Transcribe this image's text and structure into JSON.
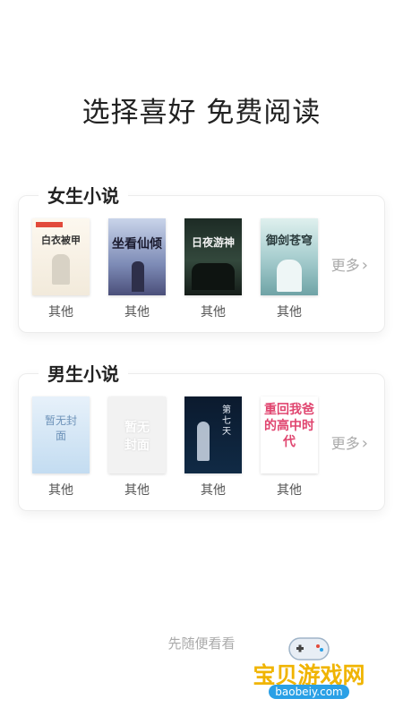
{
  "header": {
    "title": "选择喜好 免费阅读"
  },
  "sections": [
    {
      "title": "女生小说",
      "more": "更多",
      "books": [
        {
          "genre": "其他",
          "cover_text": "白衣被甲"
        },
        {
          "genre": "其他",
          "cover_text": "坐看仙倾"
        },
        {
          "genre": "其他",
          "cover_text": "日夜游神"
        },
        {
          "genre": "其他",
          "cover_text": "御剑苍穹"
        }
      ]
    },
    {
      "title": "男生小说",
      "more": "更多",
      "books": [
        {
          "genre": "其他",
          "cover_text": "暂无封面"
        },
        {
          "genre": "其他",
          "cover_text": "暂无封面"
        },
        {
          "genre": "其他",
          "cover_text": "第七天"
        },
        {
          "genre": "其他",
          "cover_text": "重回我爸的高中时代"
        }
      ]
    }
  ],
  "footer": {
    "browse_label": "先随便看看"
  },
  "watermark": {
    "cn": "宝贝游戏网",
    "en": "baobeiy.com"
  },
  "colors": {
    "accent": "#f0b400",
    "watermark_blue": "#2aa0e6"
  }
}
